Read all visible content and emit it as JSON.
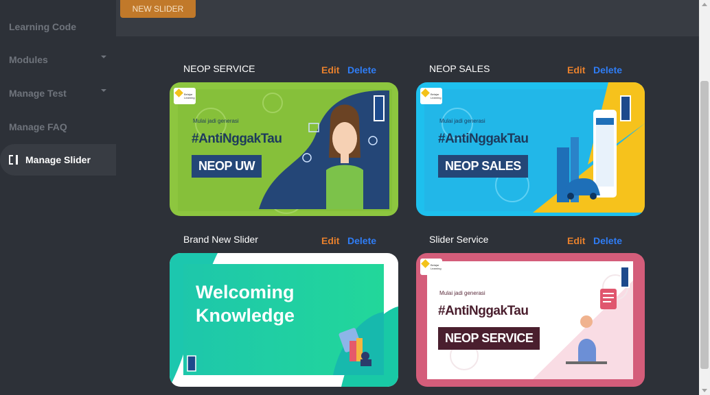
{
  "sidebar": {
    "items": [
      {
        "label": "Learning Code"
      },
      {
        "label": "Modules"
      },
      {
        "label": "Manage Test"
      },
      {
        "label": "Manage FAQ"
      },
      {
        "label": "Manage Slider"
      }
    ]
  },
  "header": {
    "new_slider_label": "NEW SLIDER"
  },
  "actions": {
    "edit": "Edit",
    "delete": "Delete"
  },
  "sliders": [
    {
      "title": "NEOP SERVICE",
      "logo_text": "Belajar Learning",
      "subtitle": "Mulai jadi generasi",
      "hashtag": "#AntiNggakTau",
      "tag": "NEOP UW"
    },
    {
      "title": "NEOP SALES",
      "logo_text": "Belajar Learning",
      "subtitle": "Mulai jadi generasi",
      "hashtag": "#AntiNggakTau",
      "tag": "NEOP SALES"
    },
    {
      "title": "Brand New Slider",
      "line1": "Welcoming",
      "line2": "Knowledge"
    },
    {
      "title": "Slider Service",
      "logo_text": "Belajar Learning",
      "subtitle": "Mulai jadi generasi",
      "hashtag": "#AntiNggakTau",
      "tag": "NEOP SERVICE"
    }
  ],
  "colors": {
    "edit": "#e8802c",
    "delete": "#2f7df6",
    "button": "#c1792a",
    "banner_green": "#8dc63f",
    "banner_blue": "#1ec0ee",
    "banner_yellow": "#f6c21c",
    "banner_teal": "#19c9a6",
    "banner_pink": "#d45d7a"
  }
}
